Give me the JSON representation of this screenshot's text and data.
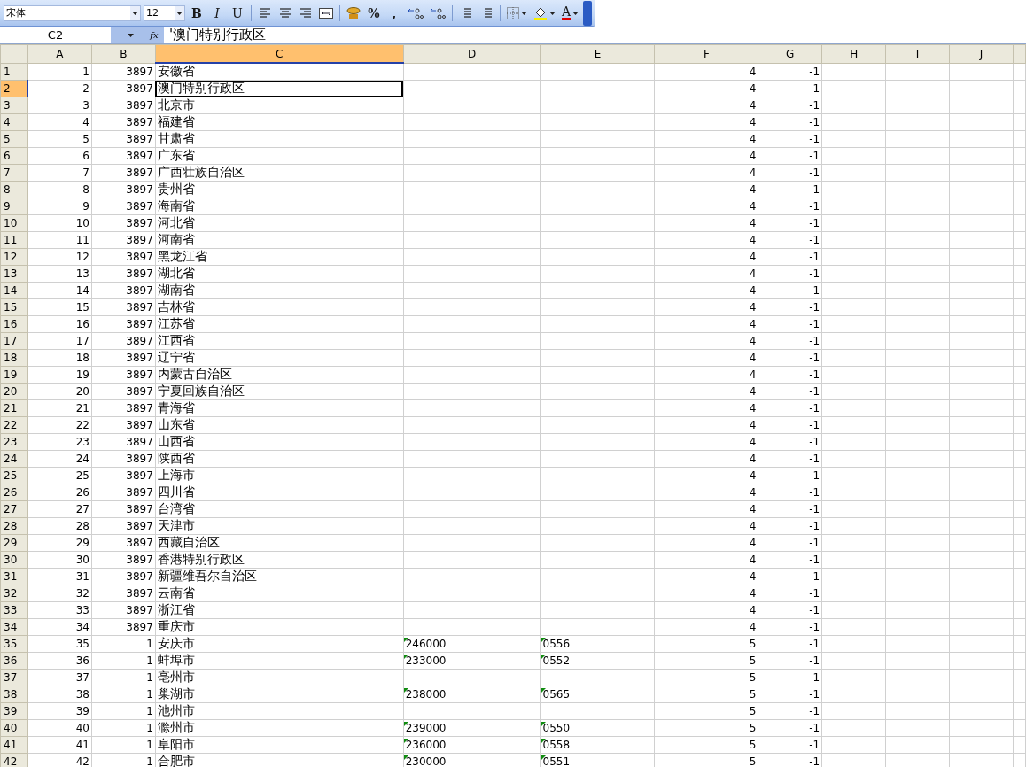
{
  "toolbar": {
    "font": "宋体",
    "size": "12",
    "buttons": [
      {
        "kind": "bold",
        "label": "B"
      },
      {
        "kind": "italic",
        "label": "I"
      },
      {
        "kind": "underline",
        "label": "U"
      },
      {
        "kind": "sep"
      },
      {
        "kind": "align-left"
      },
      {
        "kind": "align-center"
      },
      {
        "kind": "align-right"
      },
      {
        "kind": "merge"
      },
      {
        "kind": "sep"
      },
      {
        "kind": "currency"
      },
      {
        "kind": "text",
        "label": "%"
      },
      {
        "kind": "text",
        "label": ","
      },
      {
        "kind": "inc-decimal"
      },
      {
        "kind": "dec-decimal"
      },
      {
        "kind": "sep"
      },
      {
        "kind": "outdent"
      },
      {
        "kind": "indent"
      },
      {
        "kind": "sep"
      },
      {
        "kind": "borders"
      },
      {
        "kind": "fill"
      },
      {
        "kind": "font-color",
        "label": "A"
      }
    ]
  },
  "formula_bar": {
    "cell": "C2",
    "function_label": "fx",
    "content": "'澳门特别行政区"
  },
  "columns": [
    {
      "label": "A",
      "selected": false
    },
    {
      "label": "B",
      "selected": false
    },
    {
      "label": "C",
      "selected": true
    },
    {
      "label": "D",
      "selected": false
    },
    {
      "label": "E",
      "selected": false
    },
    {
      "label": "F",
      "selected": false
    },
    {
      "label": "G",
      "selected": false
    },
    {
      "label": "H",
      "selected": false
    },
    {
      "label": "I",
      "selected": false
    },
    {
      "label": "J",
      "selected": false
    }
  ],
  "rows": [
    {
      "n": "1",
      "a": "1",
      "b": "3897",
      "c": "安徽省",
      "f": "4",
      "g": "-1",
      "selected": false
    },
    {
      "n": "2",
      "a": "2",
      "b": "3897",
      "c": "澳门特别行政区",
      "f": "4",
      "g": "-1",
      "selected": true
    },
    {
      "n": "3",
      "a": "3",
      "b": "3897",
      "c": "北京市",
      "f": "4",
      "g": "-1",
      "selected": false
    },
    {
      "n": "4",
      "a": "4",
      "b": "3897",
      "c": "福建省",
      "f": "4",
      "g": "-1",
      "selected": false
    },
    {
      "n": "5",
      "a": "5",
      "b": "3897",
      "c": "甘肃省",
      "f": "4",
      "g": "-1",
      "selected": false
    },
    {
      "n": "6",
      "a": "6",
      "b": "3897",
      "c": "广东省",
      "f": "4",
      "g": "-1",
      "selected": false
    },
    {
      "n": "7",
      "a": "7",
      "b": "3897",
      "c": "广西壮族自治区",
      "f": "4",
      "g": "-1",
      "selected": false
    },
    {
      "n": "8",
      "a": "8",
      "b": "3897",
      "c": "贵州省",
      "f": "4",
      "g": "-1",
      "selected": false
    },
    {
      "n": "9",
      "a": "9",
      "b": "3897",
      "c": "海南省",
      "f": "4",
      "g": "-1",
      "selected": false
    },
    {
      "n": "10",
      "a": "10",
      "b": "3897",
      "c": "河北省",
      "f": "4",
      "g": "-1",
      "selected": false
    },
    {
      "n": "11",
      "a": "11",
      "b": "3897",
      "c": "河南省",
      "f": "4",
      "g": "-1",
      "selected": false
    },
    {
      "n": "12",
      "a": "12",
      "b": "3897",
      "c": "黑龙江省",
      "f": "4",
      "g": "-1",
      "selected": false
    },
    {
      "n": "13",
      "a": "13",
      "b": "3897",
      "c": "湖北省",
      "f": "4",
      "g": "-1",
      "selected": false
    },
    {
      "n": "14",
      "a": "14",
      "b": "3897",
      "c": "湖南省",
      "f": "4",
      "g": "-1",
      "selected": false
    },
    {
      "n": "15",
      "a": "15",
      "b": "3897",
      "c": "吉林省",
      "f": "4",
      "g": "-1",
      "selected": false
    },
    {
      "n": "16",
      "a": "16",
      "b": "3897",
      "c": "江苏省",
      "f": "4",
      "g": "-1",
      "selected": false
    },
    {
      "n": "17",
      "a": "17",
      "b": "3897",
      "c": "江西省",
      "f": "4",
      "g": "-1",
      "selected": false
    },
    {
      "n": "18",
      "a": "18",
      "b": "3897",
      "c": "辽宁省",
      "f": "4",
      "g": "-1",
      "selected": false
    },
    {
      "n": "19",
      "a": "19",
      "b": "3897",
      "c": "内蒙古自治区",
      "f": "4",
      "g": "-1",
      "selected": false
    },
    {
      "n": "20",
      "a": "20",
      "b": "3897",
      "c": "宁夏回族自治区",
      "f": "4",
      "g": "-1",
      "selected": false
    },
    {
      "n": "21",
      "a": "21",
      "b": "3897",
      "c": "青海省",
      "f": "4",
      "g": "-1",
      "selected": false
    },
    {
      "n": "22",
      "a": "22",
      "b": "3897",
      "c": "山东省",
      "f": "4",
      "g": "-1",
      "selected": false
    },
    {
      "n": "23",
      "a": "23",
      "b": "3897",
      "c": "山西省",
      "f": "4",
      "g": "-1",
      "selected": false
    },
    {
      "n": "24",
      "a": "24",
      "b": "3897",
      "c": "陕西省",
      "f": "4",
      "g": "-1",
      "selected": false
    },
    {
      "n": "25",
      "a": "25",
      "b": "3897",
      "c": "上海市",
      "f": "4",
      "g": "-1",
      "selected": false
    },
    {
      "n": "26",
      "a": "26",
      "b": "3897",
      "c": "四川省",
      "f": "4",
      "g": "-1",
      "selected": false
    },
    {
      "n": "27",
      "a": "27",
      "b": "3897",
      "c": "台湾省",
      "f": "4",
      "g": "-1",
      "selected": false
    },
    {
      "n": "28",
      "a": "28",
      "b": "3897",
      "c": "天津市",
      "f": "4",
      "g": "-1",
      "selected": false
    },
    {
      "n": "29",
      "a": "29",
      "b": "3897",
      "c": "西藏自治区",
      "f": "4",
      "g": "-1",
      "selected": false
    },
    {
      "n": "30",
      "a": "30",
      "b": "3897",
      "c": "香港特别行政区",
      "f": "4",
      "g": "-1",
      "selected": false
    },
    {
      "n": "31",
      "a": "31",
      "b": "3897",
      "c": "新疆维吾尔自治区",
      "f": "4",
      "g": "-1",
      "selected": false
    },
    {
      "n": "32",
      "a": "32",
      "b": "3897",
      "c": "云南省",
      "f": "4",
      "g": "-1",
      "selected": false
    },
    {
      "n": "33",
      "a": "33",
      "b": "3897",
      "c": "浙江省",
      "f": "4",
      "g": "-1",
      "selected": false
    },
    {
      "n": "34",
      "a": "34",
      "b": "3897",
      "c": "重庆市",
      "f": "4",
      "g": "-1",
      "selected": false
    },
    {
      "n": "35",
      "a": "35",
      "b": "1",
      "c": "安庆市",
      "d": {
        "text": "246000",
        "flagged": true
      },
      "e": {
        "text": "0556",
        "flagged": true
      },
      "f": "5",
      "g": "-1",
      "selected": false
    },
    {
      "n": "36",
      "a": "36",
      "b": "1",
      "c": "蚌埠市",
      "d": {
        "text": "233000",
        "flagged": true
      },
      "e": {
        "text": "0552",
        "flagged": true
      },
      "f": "5",
      "g": "-1",
      "selected": false
    },
    {
      "n": "37",
      "a": "37",
      "b": "1",
      "c": "亳州市",
      "f": "5",
      "g": "-1",
      "selected": false
    },
    {
      "n": "38",
      "a": "38",
      "b": "1",
      "c": "巢湖市",
      "d": {
        "text": "238000",
        "flagged": true
      },
      "e": {
        "text": "0565",
        "flagged": true
      },
      "f": "5",
      "g": "-1",
      "selected": false
    },
    {
      "n": "39",
      "a": "39",
      "b": "1",
      "c": "池州市",
      "f": "5",
      "g": "-1",
      "selected": false
    },
    {
      "n": "40",
      "a": "40",
      "b": "1",
      "c": "滁州市",
      "d": {
        "text": "239000",
        "flagged": true
      },
      "e": {
        "text": "0550",
        "flagged": true
      },
      "f": "5",
      "g": "-1",
      "selected": false
    },
    {
      "n": "41",
      "a": "41",
      "b": "1",
      "c": "阜阳市",
      "d": {
        "text": "236000",
        "flagged": true
      },
      "e": {
        "text": "0558",
        "flagged": true
      },
      "f": "5",
      "g": "-1",
      "selected": false
    },
    {
      "n": "42",
      "a": "42",
      "b": "1",
      "c": "合肥市",
      "d": {
        "text": "230000",
        "flagged": true
      },
      "e": {
        "text": "0551",
        "flagged": true
      },
      "f": "5",
      "g": "-1",
      "selected": false
    }
  ]
}
